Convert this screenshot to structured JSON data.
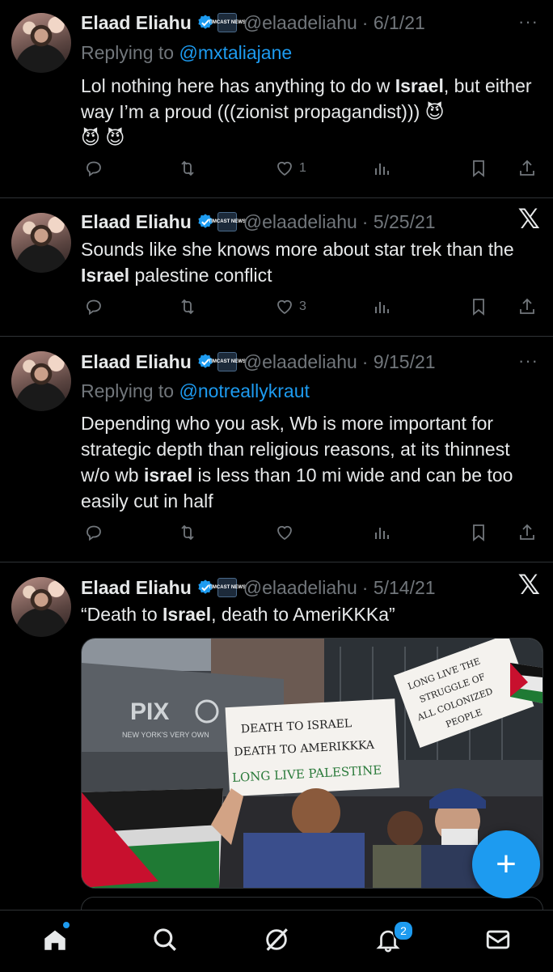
{
  "accent_color": "#1d9bf0",
  "tweets": [
    {
      "name": "Elaad Eliahu",
      "handle": "@elaadeliahu",
      "date": "· 6/1/21",
      "replying_prefix": "Replying to",
      "replying_to": "@mxtaliajane",
      "text_parts": [
        "Lol nothing here has anything to do w ",
        "Israel",
        ", but either way I’m a proud (((zionist propagandist))) ",
        "😈",
        " ",
        "😈",
        " ",
        "😈"
      ],
      "likes": "1",
      "corner_icon": "more-icon"
    },
    {
      "name": "Elaad Eliahu",
      "handle": "@elaadeliahu",
      "date": "· 5/25/21",
      "text_parts": [
        "Sounds like she knows more about star trek than the ",
        "Israel",
        " palestine conflict"
      ],
      "likes": "3",
      "corner_icon": "x-logo-icon"
    },
    {
      "name": "Elaad Eliahu",
      "handle": "@elaadeliahu",
      "date": "· 9/15/21",
      "replying_prefix": "Replying to",
      "replying_to": "@notreallykraut",
      "text_parts": [
        "Depending who you ask, Wb is more important for strategic depth than religious reasons, at its thinnest w/o wb ",
        "israel",
        " is less than 10 mi wide and can be too easily cut in half"
      ],
      "likes": "",
      "corner_icon": "more-icon"
    },
    {
      "name": "Elaad Eliahu",
      "handle": "@elaadeliahu",
      "date": "· 5/14/21",
      "text_parts": [
        "“Death to ",
        "Israel",
        ", death to AmeriKKKa”"
      ],
      "corner_icon": "x-logo-icon"
    }
  ],
  "badge_text": "TIMCAST NEWS",
  "media": {
    "building_sign": "PIX",
    "building_sub": "NEW YORK'S VERY OWN",
    "sign1_lines": [
      "DEATH TO ISRAEL",
      "DEATH TO AMERIKKKA",
      "LONG LIVE PALESTINE"
    ],
    "sign2_lines": [
      "LONG LIVE THE",
      "STRUGGLE OF",
      "ALL COLONIZED",
      "PEOPLE"
    ]
  },
  "more_glyph": "···",
  "x_glyph": "𝕏",
  "fab_glyph": "+",
  "tabbar": {
    "notifications_count": "2"
  }
}
